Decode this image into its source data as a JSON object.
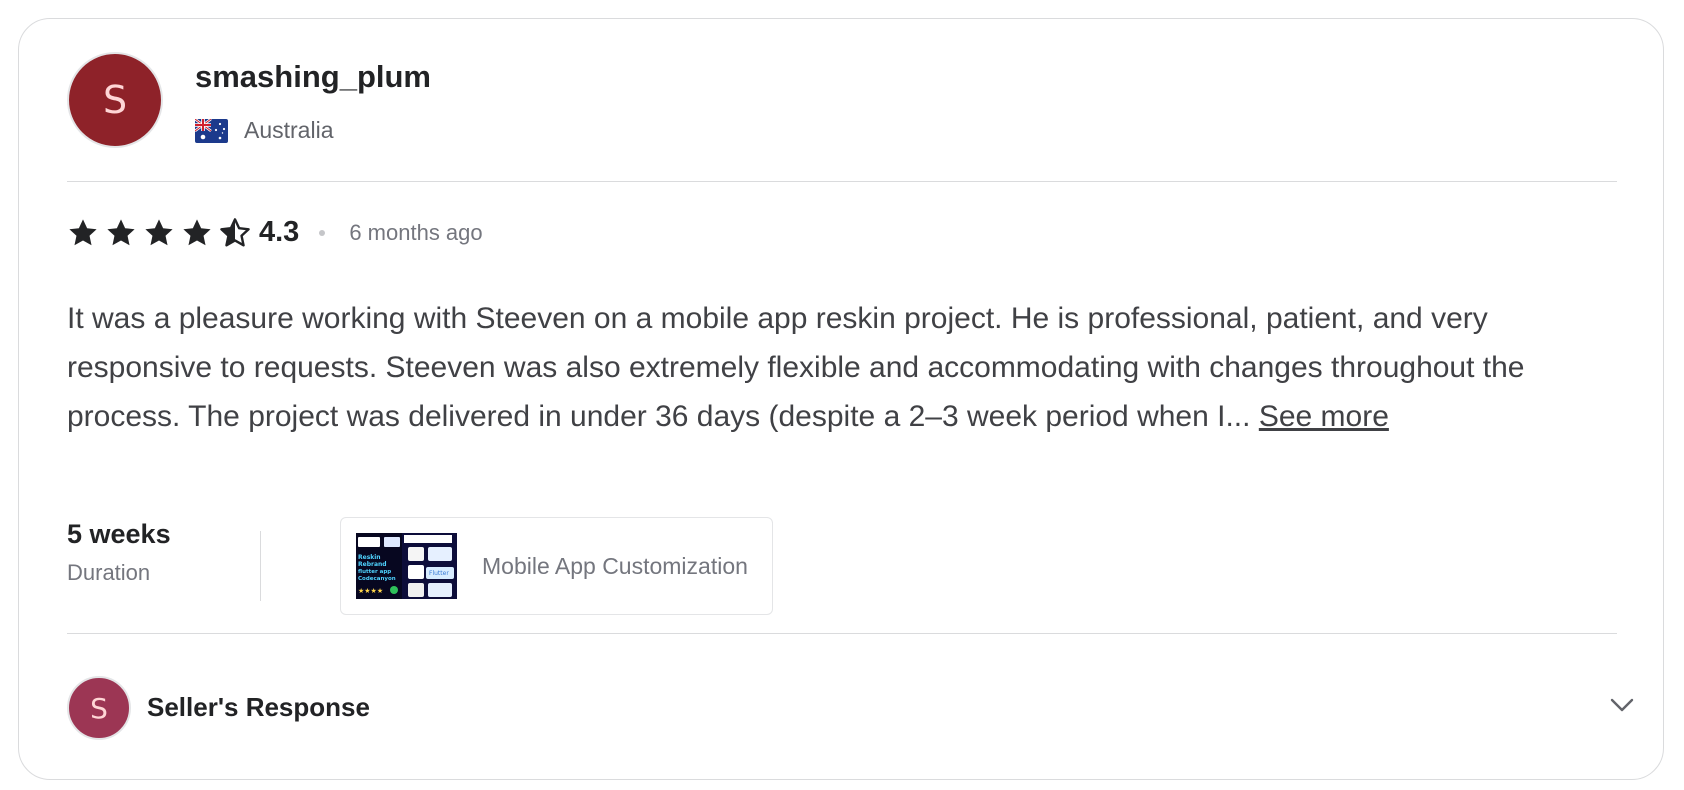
{
  "reviewer": {
    "avatar_letter": "S",
    "avatar_color": "#8e2229",
    "username": "smashing_plum",
    "country": "Australia",
    "flag_icon": "australia-flag-icon"
  },
  "review": {
    "rating": "4.3",
    "stars_out_of": 5,
    "stars_value": 4.3,
    "time_ago": "6 months ago",
    "text": "It was a pleasure working with Steeven on a mobile app reskin project. He is professional, patient, and very responsive to requests. Steeven was also extremely flexible and accommodating with changes throughout the process. The project was delivered in under 36 days (despite a 2–3 week period when I...",
    "see_more_label": "See more"
  },
  "meta": {
    "duration_value": "5 weeks",
    "duration_label": "Duration"
  },
  "gig": {
    "title": "Mobile App Customization",
    "thumbnail_texts": [
      "Reskin",
      "Rebrand",
      "flutter app",
      "Codecanyon",
      "Flutter"
    ]
  },
  "seller_response": {
    "avatar_letter": "S",
    "avatar_color": "#9c3654",
    "label": "Seller's Response",
    "toggle_icon": "chevron-down-icon"
  }
}
